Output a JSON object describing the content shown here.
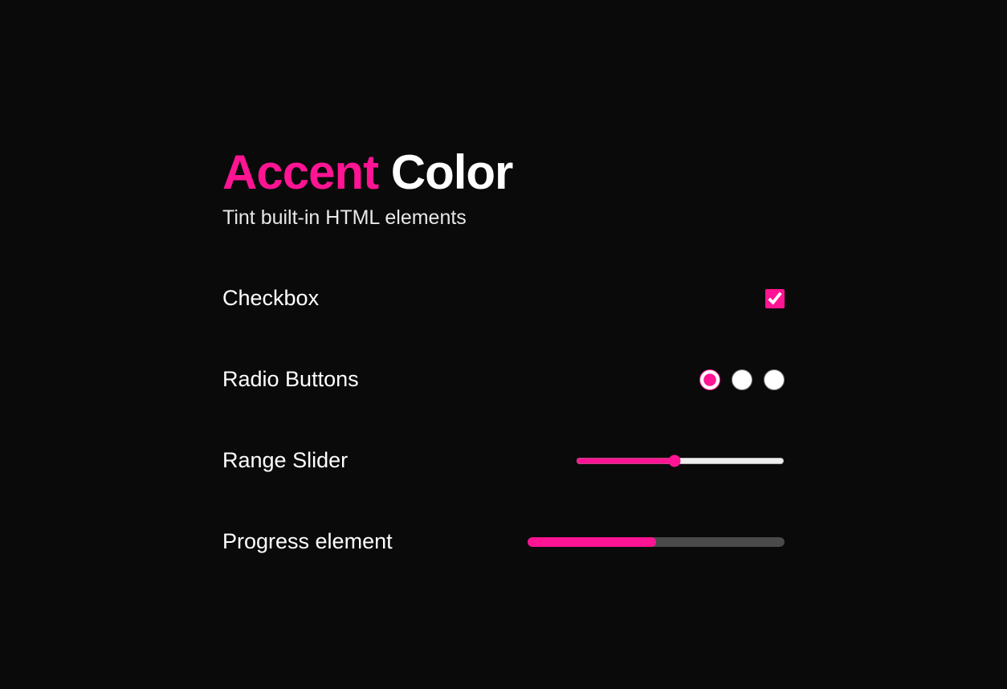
{
  "heading": {
    "accent": "Accent",
    "color": "Color"
  },
  "subheading": "Tint built-in HTML elements",
  "rows": {
    "checkbox": {
      "label": "Checkbox",
      "checked": true
    },
    "radio": {
      "label": "Radio Buttons",
      "selected_index": 0,
      "count": 3
    },
    "range": {
      "label": "Range Slider",
      "value": 47,
      "min": 0,
      "max": 100
    },
    "progress": {
      "label": "Progress element",
      "value": 50,
      "max": 100
    }
  },
  "accent_color": "#ff1493"
}
